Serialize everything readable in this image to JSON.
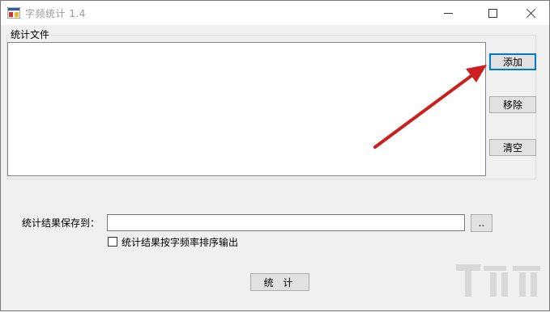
{
  "window": {
    "title": "字频统计 1.4"
  },
  "file_group": {
    "label": "统计文件",
    "list_items": []
  },
  "buttons": {
    "add": "添加",
    "remove": "移除",
    "clear": "清空",
    "browse": "..",
    "run": "统 计"
  },
  "output": {
    "label": "统计结果保存到：",
    "path_value": "",
    "sort_checkbox_label": "统计结果按字频率排序输出",
    "sort_checked": false
  },
  "annotation": {
    "arrow_color": "#cc1f1f"
  },
  "colors": {
    "default_button_border": "#0078d7",
    "window_bg": "#f0f0f0"
  }
}
